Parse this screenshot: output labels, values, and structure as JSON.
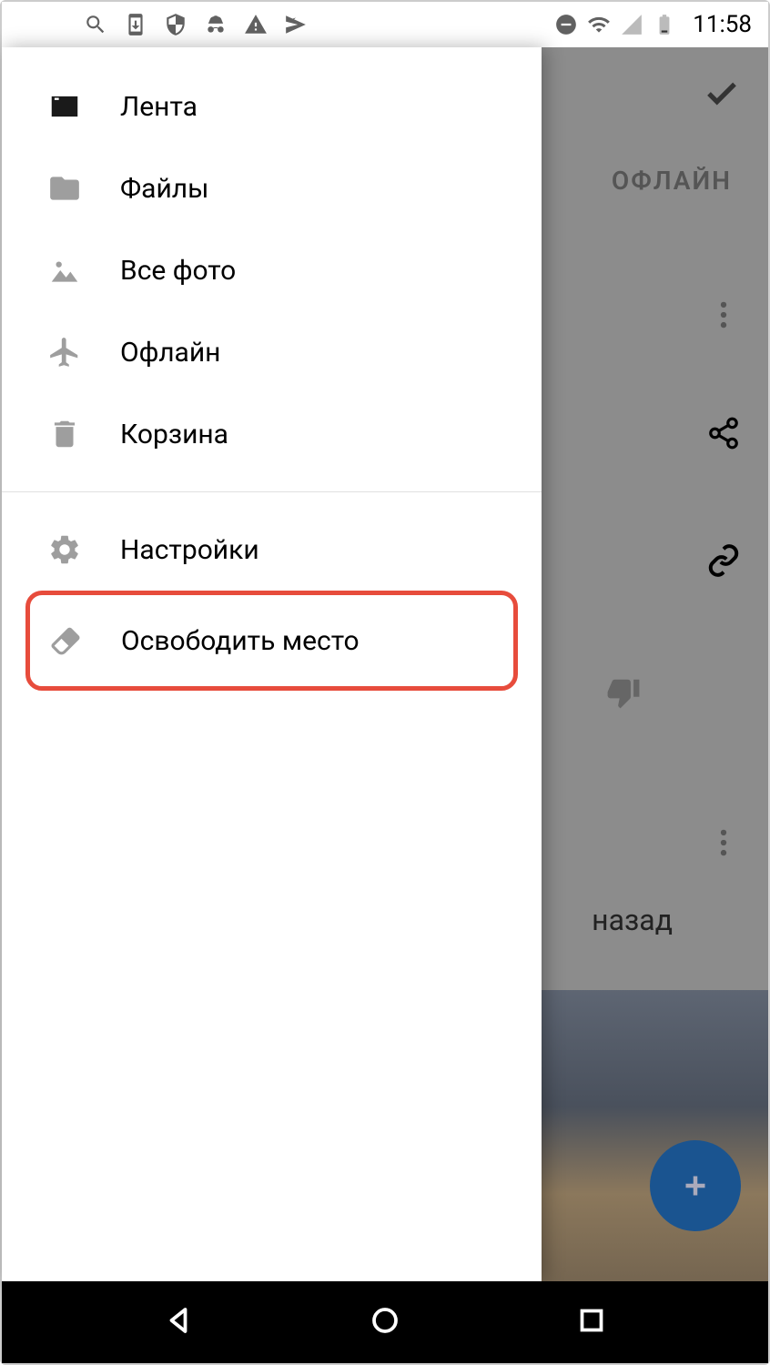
{
  "status": {
    "time": "11:58"
  },
  "drawer": {
    "items": [
      {
        "label": "Лента"
      },
      {
        "label": "Файлы"
      },
      {
        "label": "Все фото"
      },
      {
        "label": "Офлайн"
      },
      {
        "label": "Корзина"
      }
    ],
    "secondary": [
      {
        "label": "Настройки"
      },
      {
        "label": "Освободить место"
      }
    ]
  },
  "background": {
    "tab_offline": "ОФЛАЙН",
    "text_back": "назад"
  }
}
